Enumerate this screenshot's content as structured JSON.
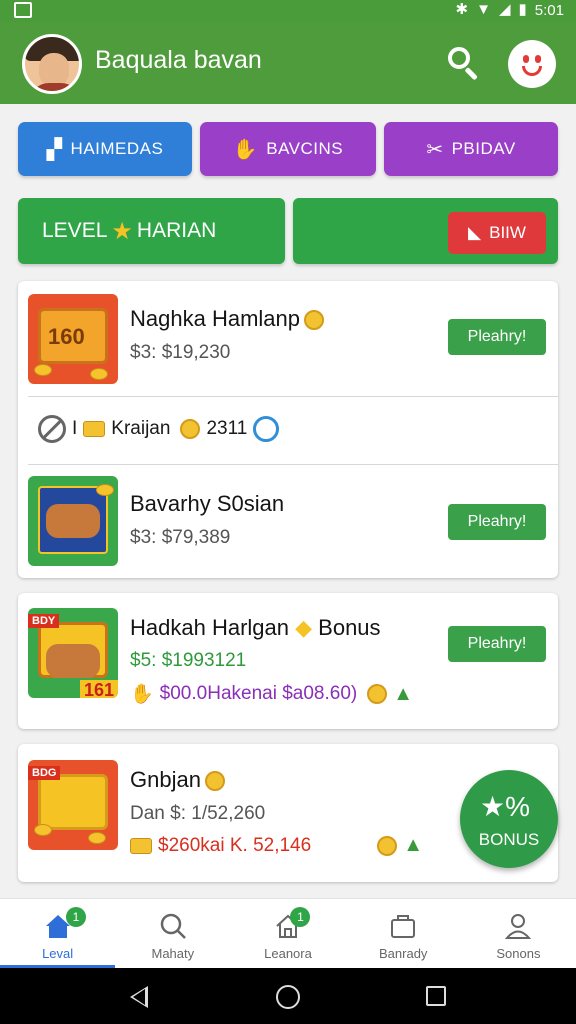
{
  "status_bar": {
    "time": "5:01"
  },
  "header": {
    "title": "Baquala bavan"
  },
  "categories": [
    {
      "label": "HAIMEDAS",
      "color": "#2f7ed8",
      "icon": "bag-icon"
    },
    {
      "label": "BAVCINS",
      "color": "#9a3fc7",
      "icon": "hand-icon"
    },
    {
      "label": "PBIDAV",
      "color": "#9a3fc7",
      "icon": "scissors-icon"
    }
  ],
  "level": {
    "label_left": "LEVEL",
    "label_right": "HARIAN"
  },
  "red_button": {
    "label": "BIIW"
  },
  "products": [
    {
      "title": "Naghka Hamlanp",
      "price": "$3: $19,230",
      "buy": "Pleahry!"
    },
    {
      "title": "Bavarhy S0sian",
      "price": "$3: $79,389",
      "buy": "Pleahry!"
    },
    {
      "title": "Hadkah Harlgan",
      "title_suffix": "Bonus",
      "price": "$5: $1993121",
      "bonus": "$00.0Hakenai $a08.60)",
      "buy": "Pleahry!"
    },
    {
      "title": "Gnbjan",
      "price": "Dan $: 1/52,260",
      "bonus_red": "$260kai K. 52,146"
    }
  ],
  "info_row": {
    "label": "Kraijan",
    "count": "2311",
    "prefix": "I"
  },
  "fab": {
    "label": "BONUS"
  },
  "bottom_nav": [
    {
      "label": "Leval",
      "active": true,
      "badge": "1"
    },
    {
      "label": "Mahaty",
      "active": false
    },
    {
      "label": "Leanora",
      "active": false,
      "badge": "1"
    },
    {
      "label": "Banrady",
      "active": false
    },
    {
      "label": "Sonons",
      "active": false
    }
  ],
  "colors": {
    "primary_green": "#4f9c3c",
    "accent_green": "#2fa548",
    "blue": "#2f7ed8",
    "purple": "#9a3fc7",
    "red": "#e0393c"
  }
}
